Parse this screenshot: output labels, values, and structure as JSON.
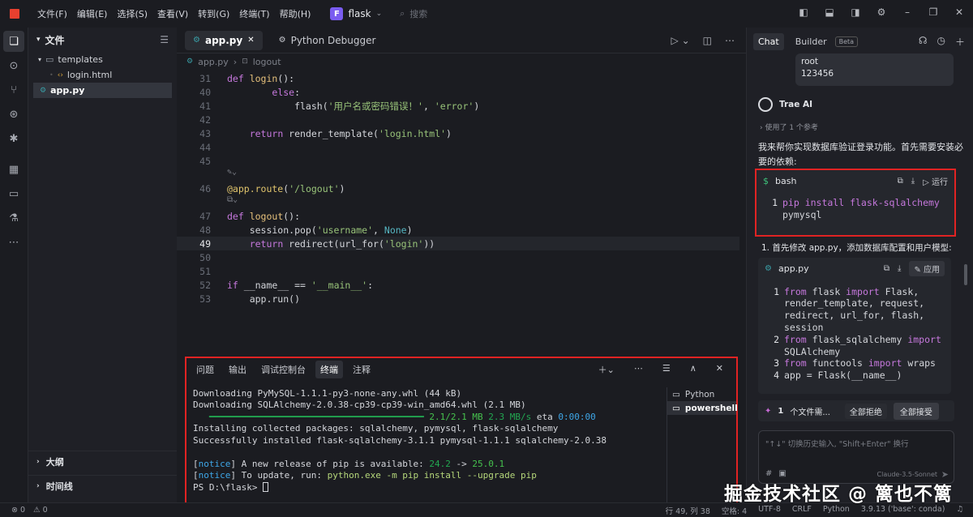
{
  "menu": [
    "文件(F)",
    "编辑(E)",
    "选择(S)",
    "查看(V)",
    "转到(G)",
    "终端(T)",
    "帮助(H)"
  ],
  "project": {
    "badge": "F",
    "name": "flask"
  },
  "search_placeholder": "搜索",
  "sidebar": {
    "title": "文件",
    "tree": [
      {
        "label": "templates",
        "type": "folder"
      },
      {
        "label": "login.html",
        "type": "html"
      },
      {
        "label": "app.py",
        "type": "py",
        "selected": true
      }
    ],
    "outline": "大纲",
    "timeline": "时间线"
  },
  "editor": {
    "tabs": [
      {
        "label": "app.py",
        "active": true
      },
      {
        "label": "Python Debugger",
        "active": false
      }
    ],
    "breadcrumb": [
      "app.py",
      "logout"
    ],
    "lines": [
      {
        "n": "31",
        "parts": [
          [
            "kw",
            "def "
          ],
          [
            "fn",
            "login"
          ],
          [
            "nm",
            "():"
          ]
        ]
      },
      {
        "n": "40",
        "parts": [
          [
            "nm",
            "        "
          ],
          [
            "kw",
            "else"
          ],
          [
            "nm",
            ":"
          ]
        ]
      },
      {
        "n": "41",
        "parts": [
          [
            "nm",
            "            flash("
          ],
          [
            "st",
            "'用户名或密码错误！'"
          ],
          [
            "nm",
            ", "
          ],
          [
            "st",
            "'error'"
          ],
          [
            "nm",
            ")"
          ]
        ]
      },
      {
        "n": "42",
        "parts": []
      },
      {
        "n": "43",
        "parts": [
          [
            "nm",
            "    "
          ],
          [
            "kw",
            "return "
          ],
          [
            "nm",
            "render_template("
          ],
          [
            "st",
            "'login.html'"
          ],
          [
            "nm",
            ")"
          ]
        ]
      },
      {
        "n": "44",
        "parts": []
      },
      {
        "n": "45",
        "parts": []
      },
      {
        "n": "46",
        "parts": [
          [
            "dc",
            "@app.route"
          ],
          [
            "nm",
            "("
          ],
          [
            "st",
            "'/logout'"
          ],
          [
            "nm",
            ")"
          ]
        ]
      },
      {
        "n": "47",
        "parts": [
          [
            "kw",
            "def "
          ],
          [
            "fn",
            "logout"
          ],
          [
            "nm",
            "():"
          ]
        ]
      },
      {
        "n": "48",
        "parts": [
          [
            "nm",
            "    session.pop("
          ],
          [
            "st",
            "'username'"
          ],
          [
            "nm",
            ", "
          ],
          [
            "cn",
            "None"
          ],
          [
            "nm",
            ")"
          ]
        ]
      },
      {
        "n": "49",
        "parts": [
          [
            "nm",
            "    "
          ],
          [
            "kw",
            "return "
          ],
          [
            "nm",
            "redirect(url_for("
          ],
          [
            "st",
            "'login'"
          ],
          [
            "nm",
            "))"
          ]
        ],
        "current": true
      },
      {
        "n": "50",
        "parts": []
      },
      {
        "n": "51",
        "parts": []
      },
      {
        "n": "52",
        "parts": [
          [
            "kw",
            "if "
          ],
          [
            "nm",
            "__name__ == "
          ],
          [
            "st",
            "'__main__'"
          ],
          [
            "nm",
            ":"
          ]
        ]
      },
      {
        "n": "53",
        "parts": [
          [
            "nm",
            "    app.run()"
          ]
        ]
      }
    ]
  },
  "terminal": {
    "tabs": [
      "问题",
      "输出",
      "调试控制台",
      "终端",
      "注释"
    ],
    "active_tab": "终端",
    "lines": [
      [
        [
          "",
          "Downloading PyMySQL-1.1.1-py3-none-any.whl (44 kB)"
        ]
      ],
      [
        [
          "",
          "Downloading SQLAlchemy-2.0.38-cp39-cp39-win_amd64.whl (2.1 MB)"
        ]
      ],
      [
        [
          "",
          "   "
        ],
        [
          "g",
          "━━━━━━━━━━━━━━━━━━━━━━━━━━━━━━━━━━━━━━━━"
        ],
        [
          "gr",
          " 2.1/2.1 MB "
        ],
        [
          "g",
          "2.3 MB/s"
        ],
        [
          "",
          " eta "
        ],
        [
          "c",
          "0:00:00"
        ]
      ],
      [
        [
          "",
          "Installing collected packages: sqlalchemy, pymysql, flask-sqlalchemy"
        ]
      ],
      [
        [
          "",
          "Successfully installed flask-sqlalchemy-3.1.1 pymysql-1.1.1 sqlalchemy-2.0.38"
        ]
      ],
      [
        [
          "",
          ""
        ]
      ],
      [
        [
          "",
          "["
        ],
        [
          "c",
          "notice"
        ],
        [
          "",
          "] A new release of pip is available: "
        ],
        [
          "g",
          "24.2"
        ],
        [
          "",
          " -> "
        ],
        [
          "gr",
          "25.0.1"
        ]
      ],
      [
        [
          "",
          "["
        ],
        [
          "c",
          "notice"
        ],
        [
          "",
          "] To update, run: "
        ],
        [
          "y",
          "python.exe -m pip install --upgrade pip"
        ]
      ],
      [
        [
          "",
          "PS D:\\flask> "
        ]
      ]
    ],
    "shells": [
      {
        "label": "Python",
        "selected": false
      },
      {
        "label": "powershell",
        "selected": true
      }
    ]
  },
  "chat": {
    "tabs": [
      "Chat",
      "Builder"
    ],
    "beta": "Beta",
    "user_message": [
      "root",
      "123456"
    ],
    "ai_name": "Trae AI",
    "reference": "使用了 1 个参考",
    "intro": "我来帮你实现数据库验证登录功能。首先需要安装必要的依赖:",
    "bash": {
      "lang": "bash",
      "run": "运行",
      "lines": [
        {
          "n": "1",
          "t": "pip install flask-sqlalchemy"
        },
        {
          "n": "",
          "t": "pymysql"
        }
      ]
    },
    "step1": "1. 首先修改 app.py，添加数据库配置和用户模型:",
    "app_block": {
      "file": "app.py",
      "apply": "应用",
      "lines": [
        {
          "n": "1",
          "parts": [
            [
              "kw",
              "from "
            ],
            [
              "nm",
              "flask "
            ],
            [
              "kw",
              "import "
            ],
            [
              "nm",
              "Flask,"
            ]
          ]
        },
        {
          "n": "",
          "parts": [
            [
              "nm",
              "render_template, request,"
            ]
          ]
        },
        {
          "n": "",
          "parts": [
            [
              "nm",
              "redirect, url_for, flash,"
            ]
          ]
        },
        {
          "n": "",
          "parts": [
            [
              "nm",
              "session"
            ]
          ]
        },
        {
          "n": "2",
          "parts": [
            [
              "kw",
              "from "
            ],
            [
              "nm",
              "flask_sqlalchemy "
            ],
            [
              "kw",
              "import"
            ]
          ]
        },
        {
          "n": "",
          "parts": [
            [
              "nm",
              "SQLAlchemy"
            ]
          ]
        },
        {
          "n": "3",
          "parts": [
            [
              "kw",
              "from "
            ],
            [
              "nm",
              "functools "
            ],
            [
              "kw",
              "import "
            ],
            [
              "nm",
              "wraps"
            ]
          ]
        },
        {
          "n": "4",
          "parts": [
            [
              "nm",
              "app = Flask(__name__)"
            ]
          ]
        }
      ]
    },
    "pending": {
      "count": "1",
      "label": "个文件需...",
      "reject": "全部拒绝",
      "accept": "全部接受"
    },
    "input_placeholder": "\"↑↓\" 切换历史输入, \"Shift+Enter\" 换行",
    "model": "Claude-3.5-Sonnet"
  },
  "status": {
    "left": [
      "⊗ 0",
      "⚠ 0"
    ],
    "right": [
      "行 49, 列 38",
      "空格: 4",
      "UTF-8",
      "CRLF",
      "Python",
      "3.9.13 ('base': conda)"
    ]
  },
  "watermark": "掘金技术社区 @ 篱也不篱"
}
